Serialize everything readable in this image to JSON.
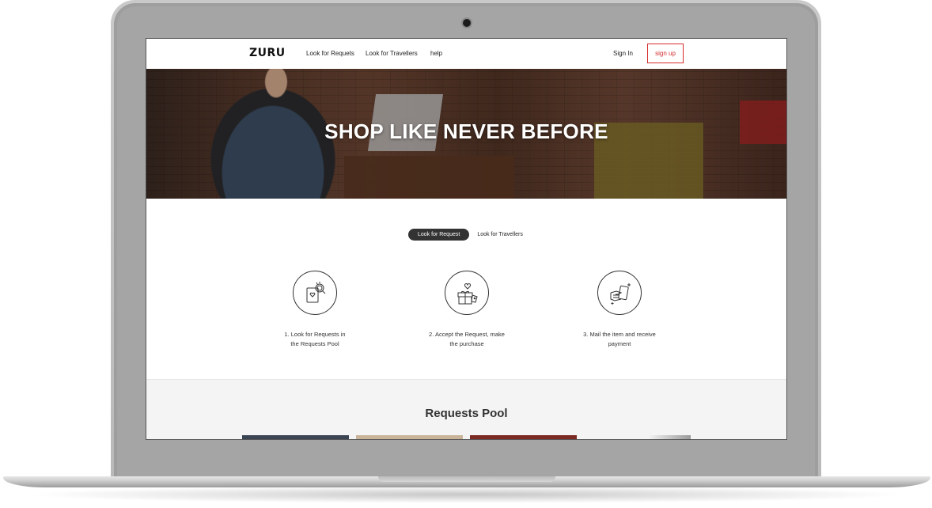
{
  "nav": {
    "logo": "ZURU",
    "links": [
      "Look for Requets",
      "Look for Travellers",
      "help"
    ],
    "sign_in": "Sign In",
    "sign_up": "sign up"
  },
  "hero": {
    "title": "SHOP LIKE NEVER BEFORE"
  },
  "toggle": {
    "active": "Look for Request",
    "inactive": "Look for Travellers"
  },
  "steps": [
    {
      "icon": "search-request-icon",
      "line1": "1. Look for Requests in",
      "line2": "the Requests Pool"
    },
    {
      "icon": "gift-purchase-icon",
      "line1": "2. Accept the Request, make",
      "line2": "the purchase"
    },
    {
      "icon": "payment-hand-icon",
      "line1": "3. Mail the item and receive",
      "line2": "payment"
    }
  ],
  "pool": {
    "title": "Requests Pool"
  },
  "colors": {
    "accent": "#d62c2c",
    "pill": "#333333"
  }
}
